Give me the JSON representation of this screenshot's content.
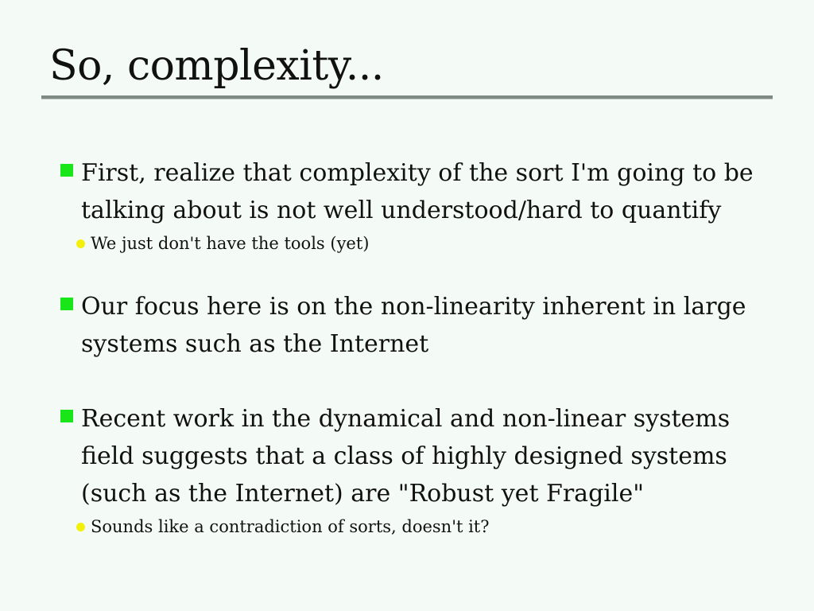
{
  "slide": {
    "title": "So, complexity...",
    "bullets": [
      {
        "text": "First, realize that complexity of the sort I'm going to be talking about is not well understood/hard to quantify",
        "sub": "We just don't have the tools (yet)"
      },
      {
        "text": "Our focus here is on the non-linearity inherent in large systems such as the Internet"
      },
      {
        "text": "Recent work in the dynamical and non-linear systems field suggests that a class of highly designed systems (such as the Internet) are \"Robust yet Fragile\"",
        "sub": "Sounds like a contradiction of sorts, doesn't it?"
      }
    ]
  },
  "colors": {
    "background": "#f4fbf7",
    "bullet_square": "#19e619",
    "sub_bullet_dot": "#f3f00c",
    "title_rule": "#7f8a84"
  }
}
